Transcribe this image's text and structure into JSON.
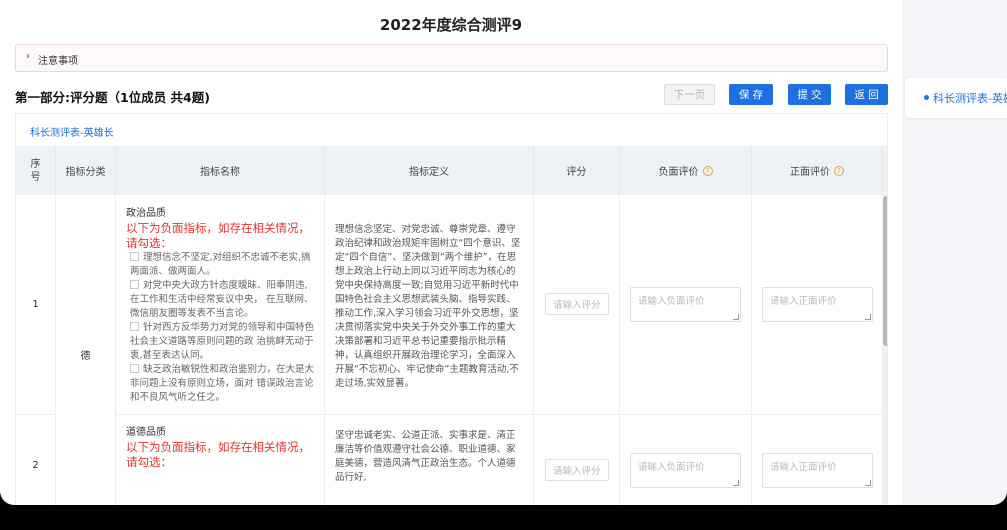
{
  "page": {
    "title": "2022年度综合测评9"
  },
  "notice": {
    "label": "注意事项"
  },
  "section": {
    "title": "第一部分:评分题（1位成员 共4题)"
  },
  "buttons": {
    "next": "下一页",
    "save": "保 存",
    "submit": "提 交",
    "back": "返 回"
  },
  "tab": {
    "label": "科长测评表-英雄长"
  },
  "side_panel": {
    "item": "科长测评表-英雄长"
  },
  "table": {
    "headers": {
      "index": "序号",
      "category": "指标分类",
      "name": "指标名称",
      "definition": "指标定义",
      "score": "评分",
      "negative": "负面评价",
      "positive": "正面评价"
    },
    "category_value": "德",
    "rows": [
      {
        "index": "1",
        "name_head": "政治品质",
        "warning": "以下为负面指标，如存在相关情况，请勾选：",
        "items": [
          "理想信念不坚定,对组织不忠诚不老实,搞两面派、做两面人。",
          "对党中央大政方针态度暧昧、阳奉阴违,在工作和生活中经常妄议中央， 在互联网、微信朋友圈等发表不当言论。",
          "针对西方反华势力对党的领导和中国特色社会主义道路等原则问题的政 治挑衅无动于衷,甚至表达认同。",
          "缺乏政治敏锐性和政治鉴别力，在大是大非问题上没有原则立场，面对 错误政治言论和不良风气听之任之。"
        ],
        "definition": "理想信念坚定、对党忠诚、尊崇党章、遵守政治纪律和政治规矩牢固树立“四个意识、坚定“四个自信”、坚决做到“两个维护”，在思想上政治上行动上同以习近平同志为核心的党中央保持高度一致;自觉用习近平新时代中国特色社会主义思想武装头脑、指导实践、推动工作,深入学习领会习近平外交思想，坚决贯彻落实党中央关于外交外事工作的重大决策部署和习近平总书记重要指示批示精神，认真组织开展政治理论学习，全面深入开展“不忘初心、牢记使命”主题教育活动,不走过场,实效显著。",
        "score_placeholder": "请输入评分",
        "negative_placeholder": "请输入负面评价",
        "positive_placeholder": "请输入正面评价"
      },
      {
        "index": "2",
        "name_head": "道德品质",
        "warning": "以下为负面指标，如存在相关情况，请勾选：",
        "definition": "坚守忠诚老实、公道正派、实事求是、清正廉洁等价值观遵守社会公德、职业道德、家庭美德，营造风清气正政治生态。个人道德品行好,",
        "score_placeholder": "请输入评分",
        "negative_placeholder": "请输入负面评价",
        "positive_placeholder": "请输入正面评价"
      }
    ]
  },
  "colors": {
    "accent": "#1e6fe0",
    "warning": "#e3342f",
    "help_icon": "#e6a23c"
  },
  "icons": {
    "notice": "chevron-right-icon",
    "help": "question-circle-icon"
  }
}
